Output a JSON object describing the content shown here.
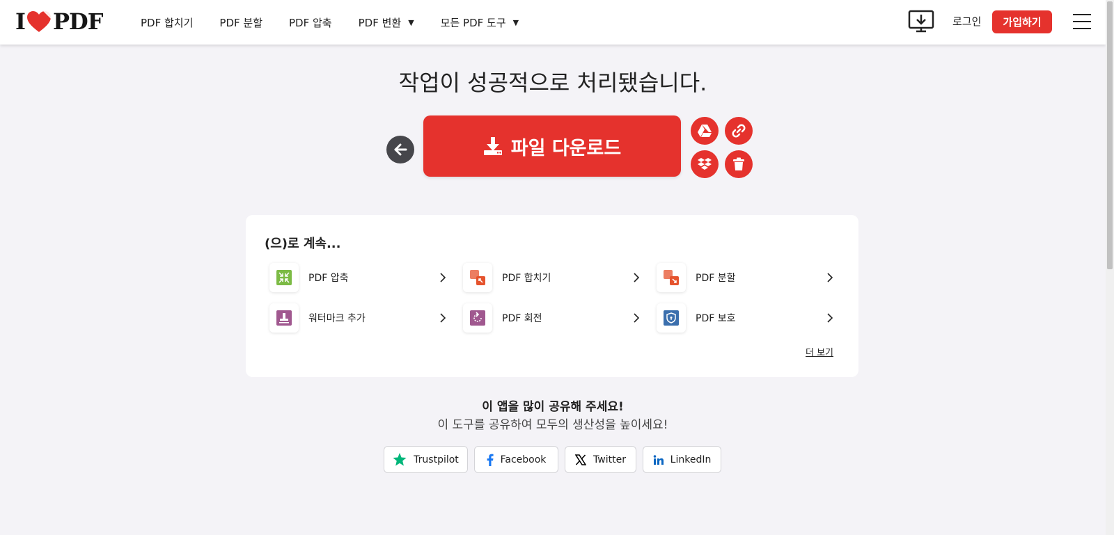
{
  "logo": {
    "text_left": "I",
    "text_right": "PDF"
  },
  "nav": {
    "items": [
      {
        "label": "PDF 합치기"
      },
      {
        "label": "PDF 분할"
      },
      {
        "label": "PDF 압축"
      },
      {
        "label": "PDF 변환",
        "caret": "▼"
      },
      {
        "label": "모든 PDF 도구",
        "caret": "▼"
      }
    ]
  },
  "header": {
    "login": "로그인",
    "signup": "가입하기"
  },
  "main": {
    "headline": "작업이 성공적으로 처리됐습니다.",
    "download_label": "파일 다운로드"
  },
  "continue": {
    "title": "(으)로 계속...",
    "tools": [
      {
        "label": "PDF 압축",
        "icon": "compress-icon",
        "color": "#7cbb45"
      },
      {
        "label": "PDF 합치기",
        "icon": "merge-icon",
        "color": "#e5532d"
      },
      {
        "label": "PDF 분할",
        "icon": "split-icon",
        "color": "#e5532d"
      },
      {
        "label": "워터마크 추가",
        "icon": "watermark-icon",
        "color": "#a0588f"
      },
      {
        "label": "PDF 회전",
        "icon": "rotate-icon",
        "color": "#a0588f"
      },
      {
        "label": "PDF 보호",
        "icon": "protect-icon",
        "color": "#3b6fad"
      }
    ],
    "more": "더 보기"
  },
  "share": {
    "title": "이 앱을 많이 공유해 주세요!",
    "subtitle": "이 도구를 공유하여 모두의 생산성을 높이세요!",
    "buttons": [
      {
        "label": "Trustpilot",
        "icon": "trustpilot-star-icon",
        "color": "#00b67a"
      },
      {
        "label": "Facebook",
        "icon": "facebook-icon",
        "color": "#1877f2"
      },
      {
        "label": "Twitter",
        "icon": "x-icon",
        "color": "#000000"
      },
      {
        "label": "LinkedIn",
        "icon": "linkedin-icon",
        "color": "#0a66c2"
      }
    ]
  },
  "colors": {
    "brand": "#e5322d",
    "background": "#f4f3f7"
  }
}
